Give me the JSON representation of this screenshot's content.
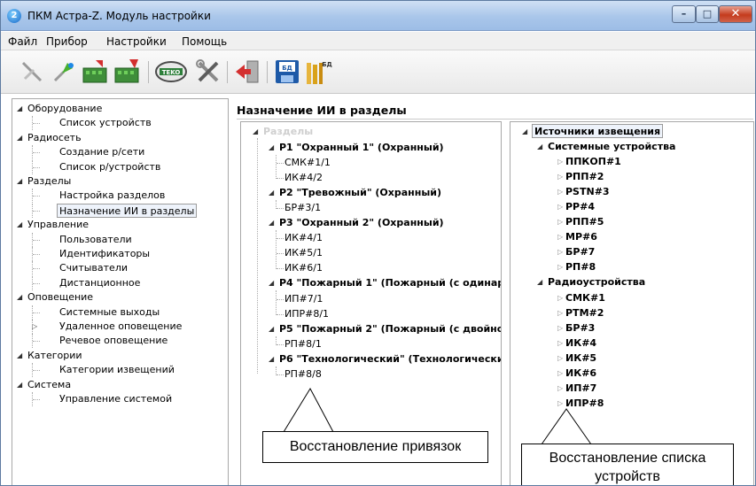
{
  "window": {
    "title": "ПКМ Астра-Z. Модуль настройки",
    "app_icon": "2"
  },
  "menu": [
    "Файл",
    "Прибор",
    "Настройки",
    "Помощь"
  ],
  "toolbar": [
    {
      "name": "disconnect-icon",
      "color": "#b0b0b0"
    },
    {
      "name": "connect-icon",
      "color": "#33a02c"
    },
    {
      "name": "read-device-icon",
      "color": "#2e7d32"
    },
    {
      "name": "write-device-icon",
      "color": "#c62828"
    },
    {
      "name": "teko-logo-icon",
      "color": "#2d7f3a"
    },
    {
      "name": "tools-icon",
      "color": "#7a7a7a"
    },
    {
      "name": "exit-icon",
      "color": "#d32f2f"
    },
    {
      "name": "save-db-icon",
      "color": "#1e5aa8"
    },
    {
      "name": "open-db-icon",
      "color": "#d9a21b"
    }
  ],
  "left_tree": [
    {
      "label": "Оборудование",
      "level": 0
    },
    {
      "label": "Список устройств",
      "level": 1
    },
    {
      "label": "Радиосеть",
      "level": 0
    },
    {
      "label": "Создание р/сети",
      "level": 1
    },
    {
      "label": "Список р/устройств",
      "level": 1
    },
    {
      "label": "Разделы",
      "level": 0
    },
    {
      "label": "Настройка разделов",
      "level": 1
    },
    {
      "label": "Назначение ИИ в разделы",
      "level": 1,
      "selected": true
    },
    {
      "label": "Управление",
      "level": 0
    },
    {
      "label": "Пользователи",
      "level": 1
    },
    {
      "label": "Идентификаторы",
      "level": 1
    },
    {
      "label": "Считыватели",
      "level": 1
    },
    {
      "label": "Дистанционное",
      "level": 1
    },
    {
      "label": "Оповещение",
      "level": 0
    },
    {
      "label": "Системные выходы",
      "level": 1
    },
    {
      "label": "Удаленное оповещение",
      "level": 1,
      "collapsed": true
    },
    {
      "label": "Речевое оповещение",
      "level": 1
    },
    {
      "label": "Категории",
      "level": 0
    },
    {
      "label": "Категории извещений",
      "level": 1
    },
    {
      "label": "Система",
      "level": 0
    },
    {
      "label": "Управление системой",
      "level": 1
    }
  ],
  "section_title": "Назначение ИИ в разделы",
  "mid_tree": {
    "root": "Разделы",
    "sections": [
      {
        "label": "P1 \"Охранный 1\" (Охранный)",
        "items": [
          "СМК#1/1",
          "ИК#4/2"
        ]
      },
      {
        "label": "P2 \"Тревожный\" (Охранный)",
        "items": [
          "БР#3/1"
        ]
      },
      {
        "label": "P3 \"Охранный 2\" (Охранный)",
        "items": [
          "ИК#4/1",
          "ИК#5/1",
          "ИК#6/1"
        ]
      },
      {
        "label": "P4 \"Пожарный 1\" (Пожарный (с одинар",
        "items": [
          "ИП#7/1",
          "ИПР#8/1"
        ]
      },
      {
        "label": "P5 \"Пожарный 2\" (Пожарный (с двойно",
        "items": [
          "РП#8/1"
        ]
      },
      {
        "label": "P6 \"Технологический\" (Технологически",
        "items": [
          "РП#8/8"
        ]
      }
    ]
  },
  "right_tree": {
    "root": "Источники извещения",
    "groups": [
      {
        "label": "Системные устройства",
        "items": [
          "ППКОП#1",
          "РПП#2",
          "PSTN#3",
          "РР#4",
          "РПП#5",
          "МР#6",
          "БР#7",
          "РП#8"
        ]
      },
      {
        "label": "Радиоустройства",
        "items": [
          "СМК#1",
          "РТМ#2",
          "БР#3",
          "ИК#4",
          "ИК#5",
          "ИК#6",
          "ИП#7",
          "ИПР#8"
        ]
      }
    ]
  },
  "callouts": {
    "restore_bindings": "Восстановление привязок",
    "restore_list_line1": "Восстановление списка",
    "restore_list_line2": "устройств"
  }
}
